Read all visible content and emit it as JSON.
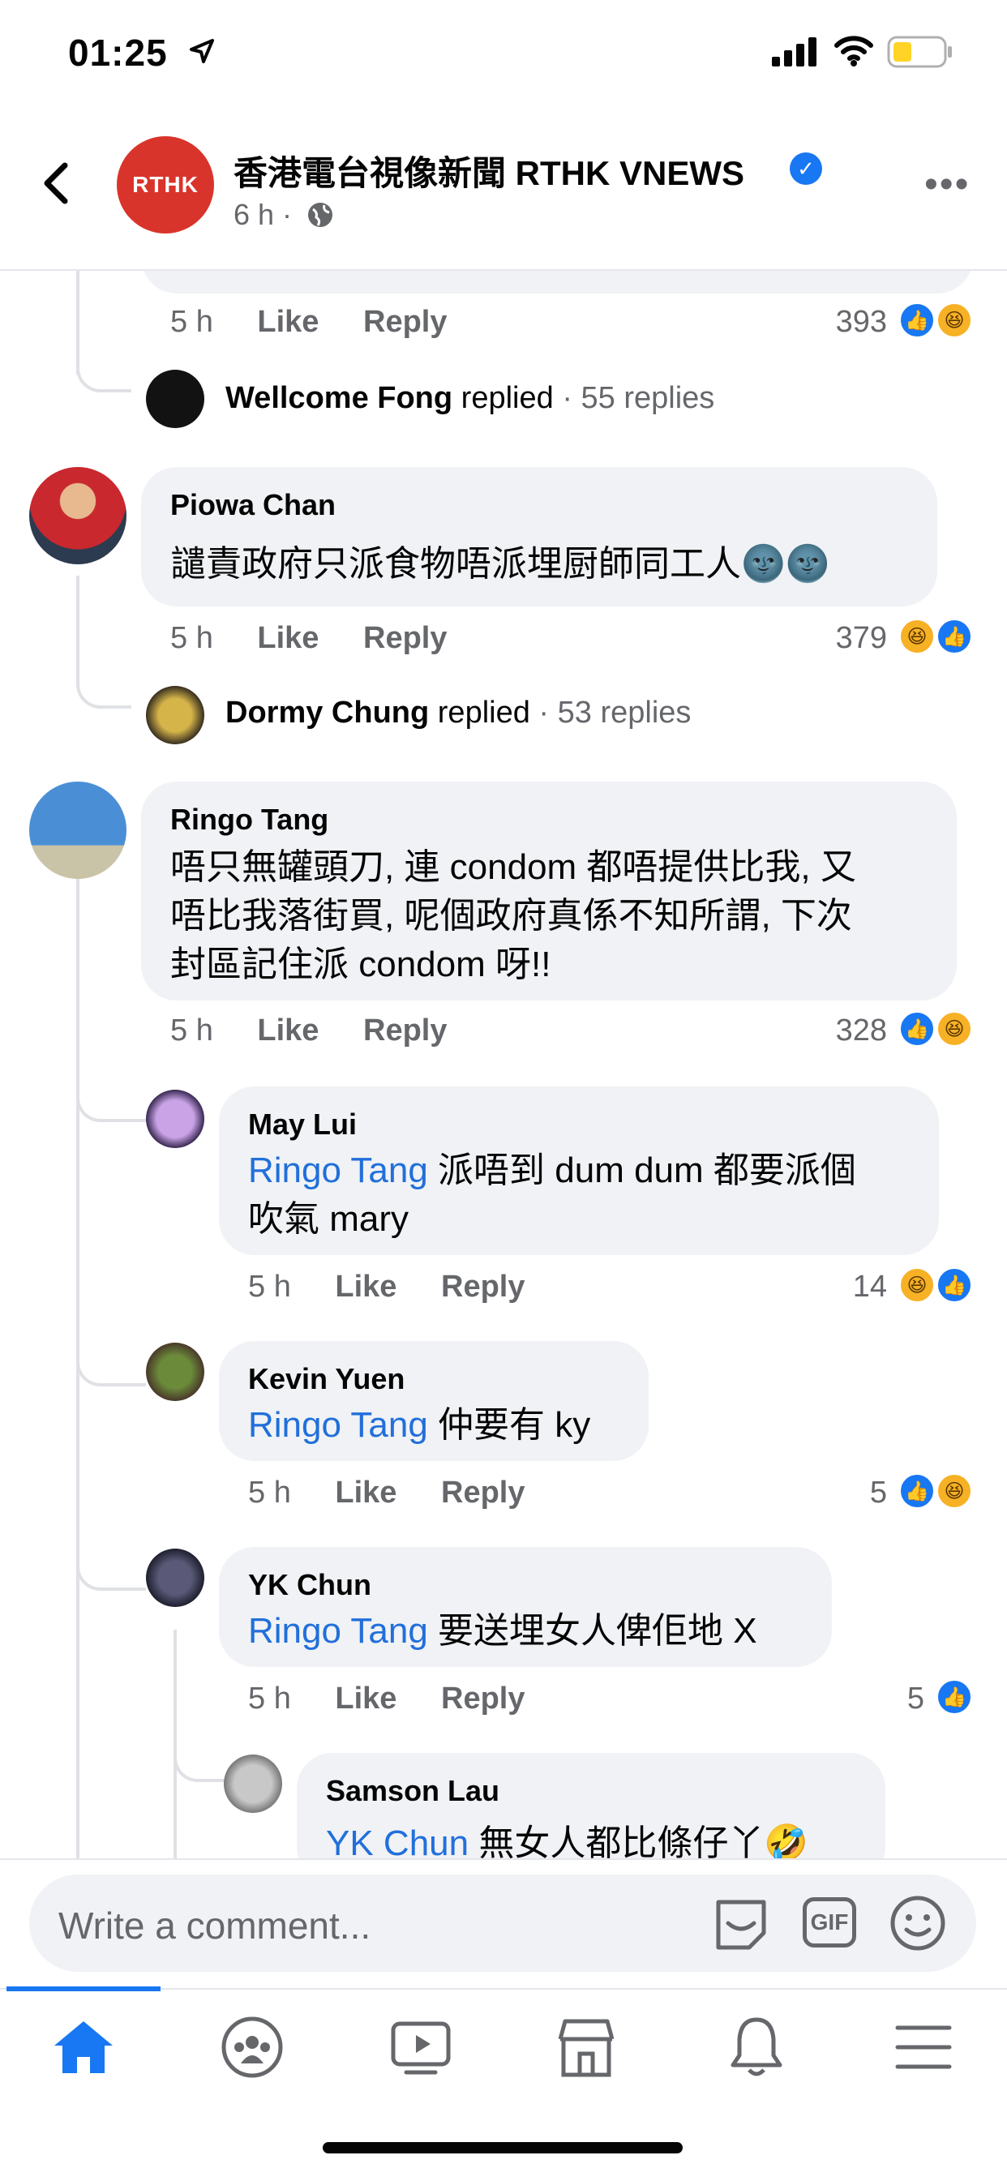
{
  "status_bar": {
    "time": "01:25"
  },
  "post_header": {
    "page_name": "香港電台視像新聞 RTHK VNEWS",
    "avatar_text": "RTHK",
    "time": "6 h ·",
    "verified": true
  },
  "comments": {
    "top": {
      "time": "5 h",
      "like": "Like",
      "reply": "Reply",
      "count": "393",
      "reactions": [
        "like",
        "haha"
      ]
    },
    "top_replied": {
      "name": "Wellcome Fong",
      "verb": "replied",
      "summary": "· 55 replies"
    },
    "piowa": {
      "name": "Piowa Chan",
      "text": "譴責政府只派食物唔派埋厨師同工人🌚🌚",
      "time": "5 h",
      "like": "Like",
      "reply": "Reply",
      "count": "379",
      "reactions": [
        "haha",
        "like"
      ]
    },
    "piowa_replied": {
      "name": "Dormy Chung",
      "verb": "replied",
      "summary": "· 53 replies"
    },
    "ringo": {
      "name": "Ringo Tang",
      "lines": [
        "唔只無罐頭刀, 連 condom 都唔提供比我, 又",
        "唔比我落街買, 呢個政府真係不知所謂, 下次",
        "封區記住派 condom 呀!!"
      ],
      "time": "5 h",
      "like": "Like",
      "reply": "Reply",
      "count": "328",
      "reactions": [
        "like",
        "haha"
      ]
    },
    "may": {
      "name": "May Lui",
      "mention": "Ringo Tang",
      "line1": " 派唔到 dum dum 都要派個",
      "line2": "吹氣 mary",
      "time": "5 h",
      "like": "Like",
      "reply": "Reply",
      "count": "14",
      "reactions": [
        "haha",
        "like"
      ]
    },
    "kevin": {
      "name": "Kevin Yuen",
      "mention": "Ringo Tang",
      "text": " 仲要有 ky",
      "time": "5 h",
      "like": "Like",
      "reply": "Reply",
      "count": "5",
      "reactions": [
        "like",
        "haha"
      ]
    },
    "yk": {
      "name": "YK Chun",
      "mention": "Ringo Tang",
      "text": " 要送埋女人俾佢地 X",
      "time": "5 h",
      "like": "Like",
      "reply": "Reply",
      "count": "5",
      "reactions": [
        "like"
      ]
    },
    "samson": {
      "name": "Samson Lau",
      "mention": "YK Chun",
      "text": " 無女人都比條仔丫🤣"
    }
  },
  "composer": {
    "placeholder": "Write a comment..."
  },
  "nav": {
    "items": [
      "home-icon",
      "groups-icon",
      "watch-icon",
      "marketplace-icon",
      "notifications-icon",
      "menu-icon"
    ]
  },
  "colors": {
    "accent": "#1877f2",
    "bubble": "#f0f2f5",
    "mention": "#216fdb",
    "rthk": "#d9342b"
  }
}
